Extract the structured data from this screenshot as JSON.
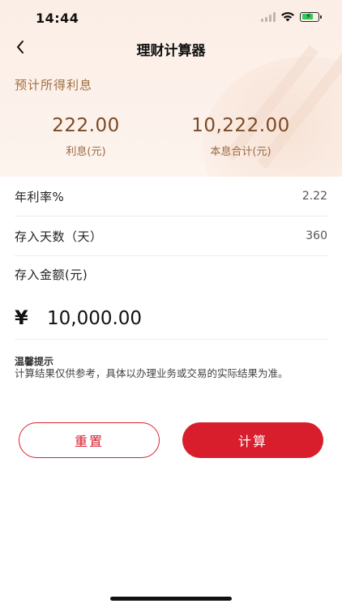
{
  "status_bar": {
    "time": "14:44"
  },
  "nav": {
    "title": "理财计算器",
    "back_icon": "chevron-left-icon"
  },
  "summary": {
    "label": "预计所得利息",
    "interest": {
      "value": "222.00",
      "label": "利息(元)"
    },
    "total": {
      "value": "10,222.00",
      "label": "本息合计(元)"
    }
  },
  "form": {
    "rate": {
      "label": "年利率%",
      "value": "2.22"
    },
    "days": {
      "label": "存入天数（天）",
      "value": "360"
    },
    "amount": {
      "label": "存入金额(元)",
      "currency": "¥",
      "value": "10,000.00"
    }
  },
  "tip": {
    "title": "温馨提示",
    "text": "计算结果仅供参考，具体以办理业务或交易的实际结果为准。"
  },
  "buttons": {
    "reset": "重置",
    "calculate": "计算"
  },
  "colors": {
    "accent": "#d81e2c",
    "hero_bg": "#fbeee6",
    "hero_text": "#7a4a25"
  }
}
